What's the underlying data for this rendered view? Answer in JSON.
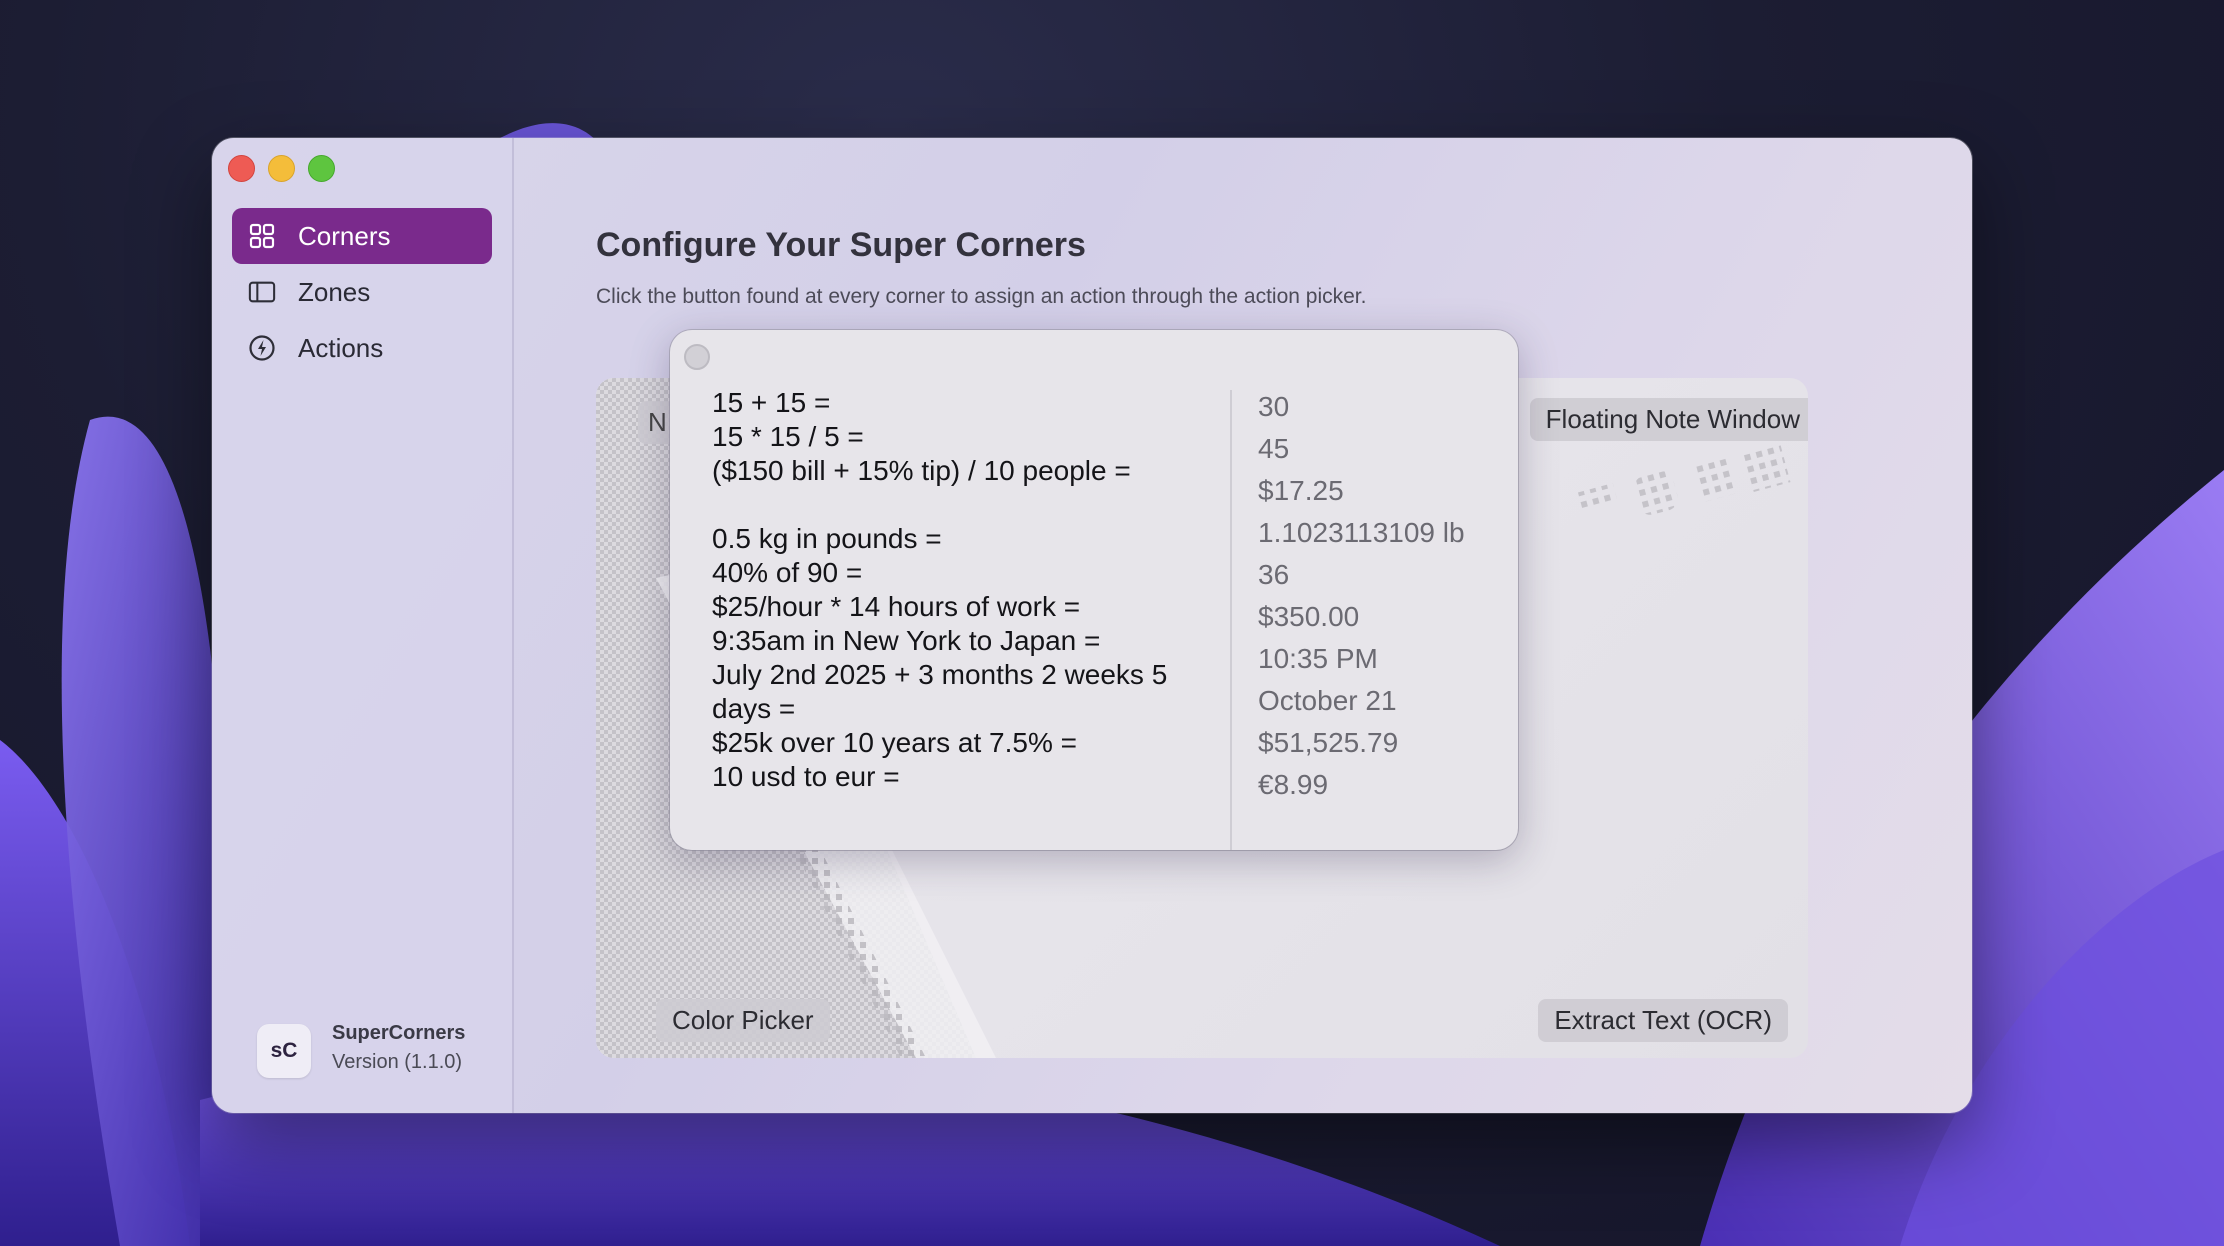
{
  "window": {
    "traffic_lights": [
      "close",
      "minimize",
      "zoom"
    ]
  },
  "sidebar": {
    "items": [
      {
        "label": "Corners",
        "icon": "grid-icon",
        "active": true
      },
      {
        "label": "Zones",
        "icon": "sidebar-panel-icon",
        "active": false
      },
      {
        "label": "Actions",
        "icon": "bolt-circle-icon",
        "active": false
      }
    ],
    "app": {
      "badge": "sC",
      "name": "SuperCorners",
      "version": "Version (1.1.0)"
    }
  },
  "main": {
    "title": "Configure Your Super Corners",
    "subtitle": "Click the button found at every corner to assign an action through the action picker.",
    "corners": {
      "top_left": "N",
      "top_right": "Floating Note Window",
      "bottom_left": "Color Picker",
      "bottom_right": "Extract Text (OCR)"
    }
  },
  "calculator": {
    "expressions": [
      "15 + 15 =",
      "15 * 15 / 5 =",
      "($150 bill + 15% tip) / 10 people =",
      "",
      "0.5 kg in pounds =",
      "40% of 90 =",
      "$25/hour * 14 hours of work =",
      "9:35am in New York to Japan =",
      "July 2nd 2025 + 3 months 2 weeks 5",
      "days =",
      "$25k over 10 years at 7.5% =",
      "10 usd to eur ="
    ],
    "results": [
      "30",
      "45",
      "$17.25",
      "1.1023113109 lb",
      "36",
      "$350.00",
      "10:35 PM",
      "October 21",
      "$51,525.79",
      "€8.99"
    ]
  },
  "colors": {
    "accent": "#7a2a8c",
    "close": "#ee5b54",
    "minimize": "#f4bd3a",
    "zoom": "#5ec53f"
  }
}
